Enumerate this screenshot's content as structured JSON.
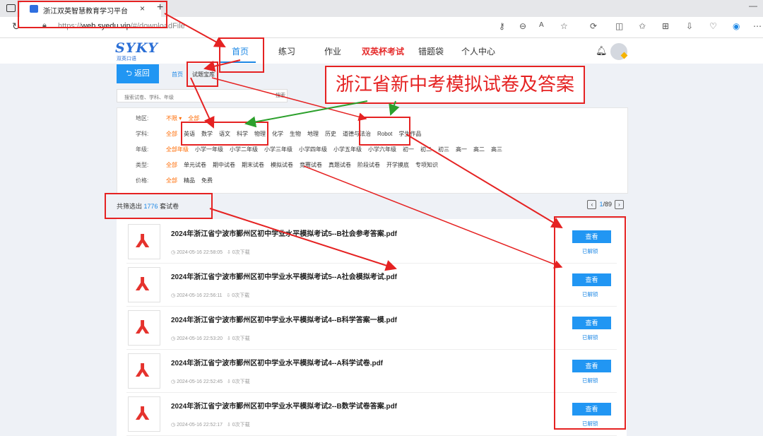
{
  "browser": {
    "tab_title": "浙江双英智慧教育学习平台",
    "tab_close": "×",
    "new_tab": "+",
    "url_prefix": "https://",
    "url_host": "web.syedu.vip",
    "url_path": "/#/downloadFile"
  },
  "site": {
    "logo": "SYKY",
    "logo_sub": "双英口语",
    "nav": [
      "首页",
      "练习",
      "作业",
      "双英杯考试",
      "错题袋",
      "个人中心"
    ]
  },
  "toolbar": {
    "back_label": "返回",
    "crumb_home": "首页",
    "crumb_current": "试题宝库",
    "search_placeholder": "搜索试卷、学科、年级",
    "search_button": "搜索"
  },
  "filters": [
    {
      "label": "地区:",
      "items": [
        "不限 ▾",
        "全部"
      ],
      "selected": [
        0,
        1
      ]
    },
    {
      "label": "学科:",
      "items": [
        "全部",
        "英语",
        "数学",
        "语文",
        "科学",
        "物理",
        "化学",
        "生物",
        "地理",
        "历史",
        "道德与法治",
        "Robot",
        "学生作品"
      ],
      "selected": [
        0
      ]
    },
    {
      "label": "年级:",
      "items": [
        "全部年级",
        "小学一年级",
        "小学二年级",
        "小学三年级",
        "小学四年级",
        "小学五年级",
        "小学六年级",
        "初一",
        "初二",
        "初三",
        "高一",
        "高二",
        "高三"
      ],
      "selected": [
        0
      ]
    },
    {
      "label": "类型:",
      "items": [
        "全部",
        "单元试卷",
        "期中试卷",
        "期末试卷",
        "模拟试卷",
        "竞赛试卷",
        "真题试卷",
        "阶段试卷",
        "开学摸底",
        "专项知识"
      ],
      "selected": [
        0
      ]
    },
    {
      "label": "价格:",
      "items": [
        "全部",
        "精品",
        "免费"
      ],
      "selected": [
        0
      ]
    }
  ],
  "results": {
    "prefix": "共筛选出",
    "count": "1776",
    "suffix": "套试卷",
    "page_current": "1",
    "page_total": "/89"
  },
  "files": [
    {
      "name": "2024年浙江省宁波市鄞州区初中学业水平模拟考试5--B社会参考答案.pdf",
      "time": "2024-05-16 22:58:05",
      "downloads": "0次下载"
    },
    {
      "name": "2024年浙江省宁波市鄞州区初中学业水平模拟考试5--A社会模拟考试.pdf",
      "time": "2024-05-16 22:56:11",
      "downloads": "0次下载"
    },
    {
      "name": "2024年浙江省宁波市鄞州区初中学业水平模拟考试4--B科学答案一模.pdf",
      "time": "2024-05-16 22:53:20",
      "downloads": "0次下载"
    },
    {
      "name": "2024年浙江省宁波市鄞州区初中学业水平模拟考试4--A科学试卷.pdf",
      "time": "2024-05-16 22:52:45",
      "downloads": "0次下载"
    },
    {
      "name": "2024年浙江省宁波市鄞州区初中学业水平模拟考试2--B数学试卷答案.pdf",
      "time": "2024-05-16 22:52:17",
      "downloads": "0次下载"
    }
  ],
  "file_actions": {
    "view": "查看",
    "status": "已解锁"
  },
  "annotation": {
    "caption": "浙江省新中考模拟试卷及答案"
  },
  "colors": {
    "accent": "#2196f3",
    "annotation": "#e52222",
    "arrow_green": "#2ca02c",
    "selected": "#ff6a00"
  }
}
